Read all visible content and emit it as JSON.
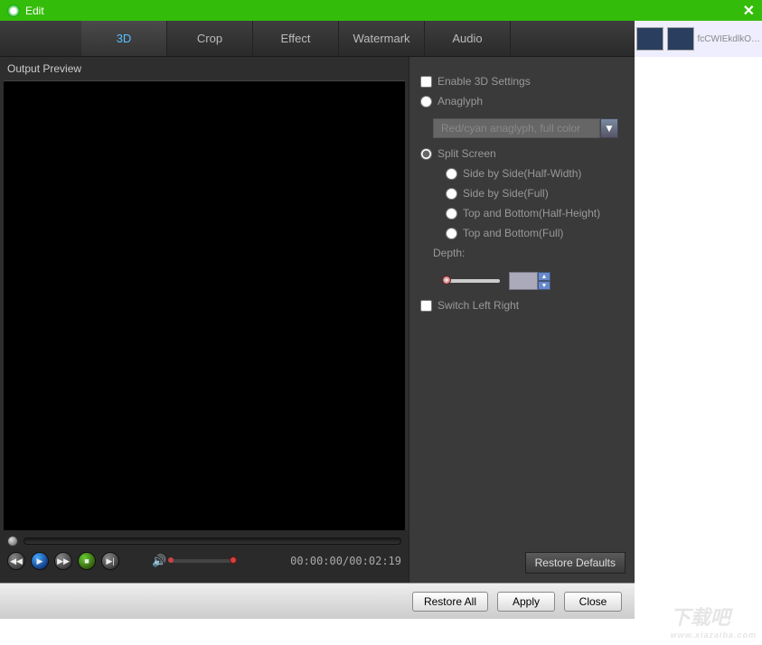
{
  "titlebar": {
    "title": "Edit"
  },
  "tabs": {
    "t3d": "3D",
    "crop": "Crop",
    "effect": "Effect",
    "watermark": "Watermark",
    "audio": "Audio"
  },
  "preview": {
    "label": "Output Preview",
    "time": "00:00:00/00:02:19"
  },
  "settings": {
    "enable": "Enable 3D Settings",
    "anaglyph": "Anaglyph",
    "anaglyph_mode": "Red/cyan anaglyph, full color",
    "split": "Split Screen",
    "sbs_half": "Side by Side(Half-Width)",
    "sbs_full": "Side by Side(Full)",
    "tb_half": "Top and Bottom(Half-Height)",
    "tb_full": "Top and Bottom(Full)",
    "depth": "Depth:",
    "switch": "Switch Left Right",
    "restore_defaults": "Restore Defaults"
  },
  "footer": {
    "restore_all": "Restore All",
    "apply": "Apply",
    "close": "Close"
  },
  "bg": {
    "label": "fcCWIEkdlkO…",
    "wm": "下载吧",
    "wm_url": "www.xiazaiba.com"
  }
}
